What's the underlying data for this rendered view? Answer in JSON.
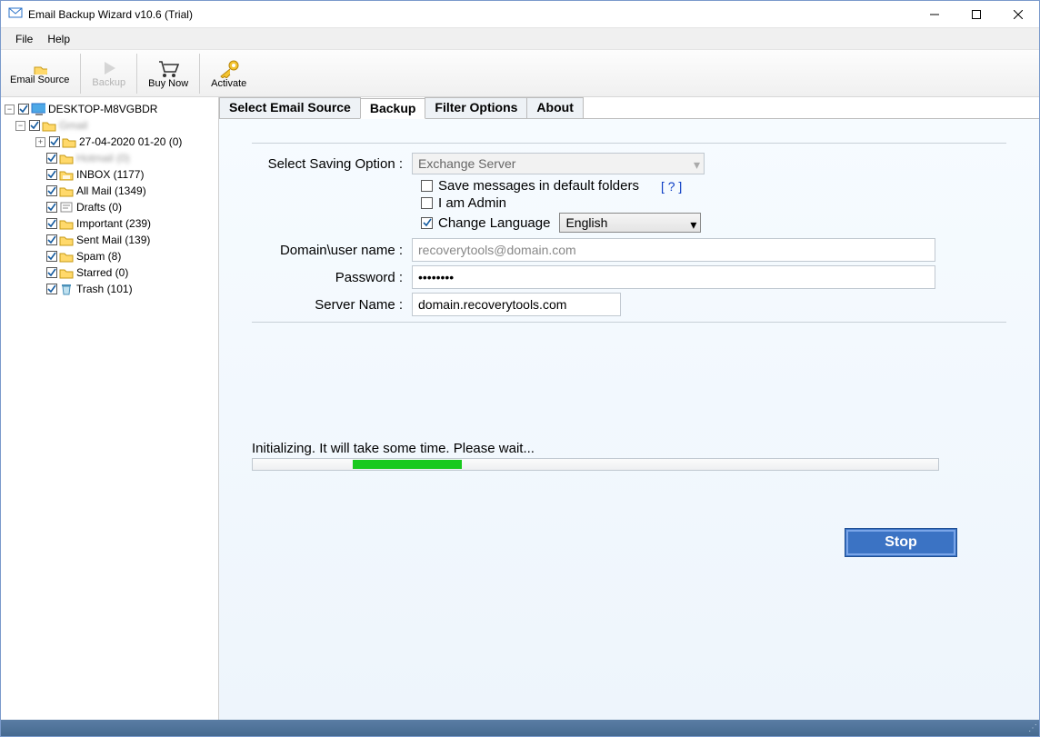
{
  "window": {
    "title": "Email Backup Wizard v10.6 (Trial)"
  },
  "menubar": {
    "file": "File",
    "help": "Help"
  },
  "toolbar": {
    "email_source": "Email Source",
    "backup": "Backup",
    "buy_now": "Buy Now",
    "activate": "Activate"
  },
  "tree": {
    "root": "DESKTOP-M8VGBDR",
    "account": "Gmail",
    "items": [
      "27-04-2020 01-20 (0)",
      "Hotmail (0)",
      "INBOX (1177)",
      "All Mail (1349)",
      "Drafts (0)",
      "Important (239)",
      "Sent Mail (139)",
      "Spam (8)",
      "Starred (0)",
      "Trash (101)"
    ]
  },
  "tabs": {
    "select_source": "Select Email Source",
    "backup": "Backup",
    "filter": "Filter Options",
    "about": "About"
  },
  "form": {
    "saving_option_label": "Select Saving Option :",
    "saving_option_value": "Exchange Server",
    "save_default_label": "Save messages in default folders",
    "help_link": "[ ? ]",
    "i_am_admin_label": "I am Admin",
    "change_language_label": "Change Language",
    "language_value": "English",
    "domain_user_label": "Domain\\user name :",
    "domain_user_value": "recoverytools@domain.com",
    "password_label": "Password :",
    "password_value": "••••••••",
    "server_name_label": "Server Name :",
    "server_name_value": "domain.recoverytools.com"
  },
  "progress": {
    "label": "Initializing. It will take some time. Please wait..."
  },
  "buttons": {
    "stop": "Stop"
  }
}
